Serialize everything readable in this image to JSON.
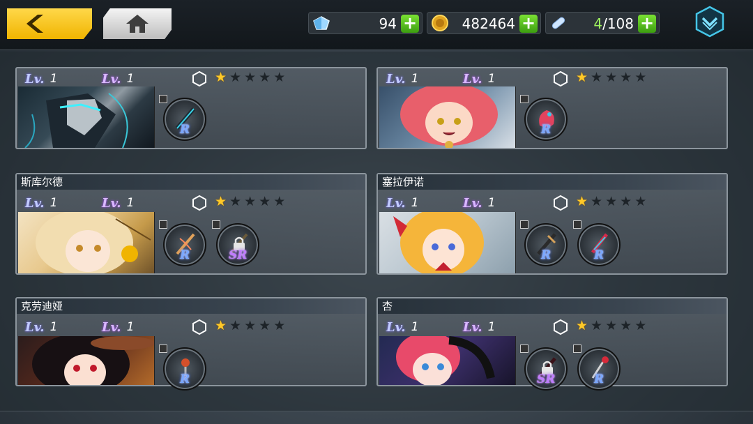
{
  "resources": {
    "crystal": {
      "value": "94",
      "icon": "crystal-icon"
    },
    "gold": {
      "value": "482464",
      "icon": "gold-coin-icon"
    },
    "capacity": {
      "value_current": "4",
      "value_max": "/108",
      "icon": "capsule-icon"
    }
  },
  "colors": {
    "accent": "#f0b400",
    "plus": "#4bb81c",
    "star": "#ffc928"
  },
  "cards": [
    {
      "name": "",
      "lv_a": "1",
      "lv_b": "1",
      "stars": 1,
      "rank1": "R",
      "rank2": null
    },
    {
      "name": "",
      "lv_a": "1",
      "lv_b": "1",
      "stars": 1,
      "rank1": "R",
      "rank2": null
    },
    {
      "name": "斯库尔德",
      "lv_a": "1",
      "lv_b": "1",
      "stars": 1,
      "rank1": "R",
      "rank2": "SR"
    },
    {
      "name": "塞拉伊诺",
      "lv_a": "1",
      "lv_b": "1",
      "stars": 1,
      "rank1": "R",
      "rank2": "R"
    },
    {
      "name": "克劳迪娅",
      "lv_a": "1",
      "lv_b": "1",
      "stars": 1,
      "rank1": "R",
      "rank2": null
    },
    {
      "name": "杏",
      "lv_a": "1",
      "lv_b": "1",
      "stars": 1,
      "rank1": "SR",
      "rank2": "R"
    }
  ],
  "labels": {
    "lv": "Lv.",
    "star_on": "★",
    "star_off": "★"
  }
}
